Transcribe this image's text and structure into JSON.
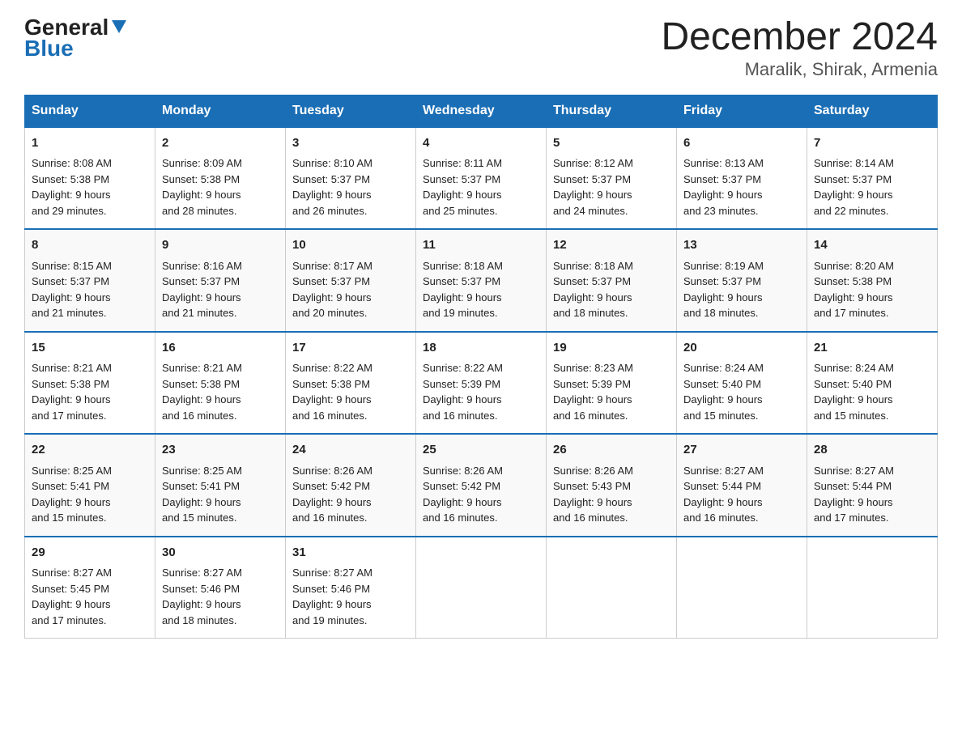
{
  "header": {
    "logo_line1": "General",
    "logo_line2": "Blue",
    "title": "December 2024",
    "subtitle": "Maralik, Shirak, Armenia"
  },
  "columns": [
    "Sunday",
    "Monday",
    "Tuesday",
    "Wednesday",
    "Thursday",
    "Friday",
    "Saturday"
  ],
  "weeks": [
    [
      {
        "day": "1",
        "info": "Sunrise: 8:08 AM\nSunset: 5:38 PM\nDaylight: 9 hours\nand 29 minutes."
      },
      {
        "day": "2",
        "info": "Sunrise: 8:09 AM\nSunset: 5:38 PM\nDaylight: 9 hours\nand 28 minutes."
      },
      {
        "day": "3",
        "info": "Sunrise: 8:10 AM\nSunset: 5:37 PM\nDaylight: 9 hours\nand 26 minutes."
      },
      {
        "day": "4",
        "info": "Sunrise: 8:11 AM\nSunset: 5:37 PM\nDaylight: 9 hours\nand 25 minutes."
      },
      {
        "day": "5",
        "info": "Sunrise: 8:12 AM\nSunset: 5:37 PM\nDaylight: 9 hours\nand 24 minutes."
      },
      {
        "day": "6",
        "info": "Sunrise: 8:13 AM\nSunset: 5:37 PM\nDaylight: 9 hours\nand 23 minutes."
      },
      {
        "day": "7",
        "info": "Sunrise: 8:14 AM\nSunset: 5:37 PM\nDaylight: 9 hours\nand 22 minutes."
      }
    ],
    [
      {
        "day": "8",
        "info": "Sunrise: 8:15 AM\nSunset: 5:37 PM\nDaylight: 9 hours\nand 21 minutes."
      },
      {
        "day": "9",
        "info": "Sunrise: 8:16 AM\nSunset: 5:37 PM\nDaylight: 9 hours\nand 21 minutes."
      },
      {
        "day": "10",
        "info": "Sunrise: 8:17 AM\nSunset: 5:37 PM\nDaylight: 9 hours\nand 20 minutes."
      },
      {
        "day": "11",
        "info": "Sunrise: 8:18 AM\nSunset: 5:37 PM\nDaylight: 9 hours\nand 19 minutes."
      },
      {
        "day": "12",
        "info": "Sunrise: 8:18 AM\nSunset: 5:37 PM\nDaylight: 9 hours\nand 18 minutes."
      },
      {
        "day": "13",
        "info": "Sunrise: 8:19 AM\nSunset: 5:37 PM\nDaylight: 9 hours\nand 18 minutes."
      },
      {
        "day": "14",
        "info": "Sunrise: 8:20 AM\nSunset: 5:38 PM\nDaylight: 9 hours\nand 17 minutes."
      }
    ],
    [
      {
        "day": "15",
        "info": "Sunrise: 8:21 AM\nSunset: 5:38 PM\nDaylight: 9 hours\nand 17 minutes."
      },
      {
        "day": "16",
        "info": "Sunrise: 8:21 AM\nSunset: 5:38 PM\nDaylight: 9 hours\nand 16 minutes."
      },
      {
        "day": "17",
        "info": "Sunrise: 8:22 AM\nSunset: 5:38 PM\nDaylight: 9 hours\nand 16 minutes."
      },
      {
        "day": "18",
        "info": "Sunrise: 8:22 AM\nSunset: 5:39 PM\nDaylight: 9 hours\nand 16 minutes."
      },
      {
        "day": "19",
        "info": "Sunrise: 8:23 AM\nSunset: 5:39 PM\nDaylight: 9 hours\nand 16 minutes."
      },
      {
        "day": "20",
        "info": "Sunrise: 8:24 AM\nSunset: 5:40 PM\nDaylight: 9 hours\nand 15 minutes."
      },
      {
        "day": "21",
        "info": "Sunrise: 8:24 AM\nSunset: 5:40 PM\nDaylight: 9 hours\nand 15 minutes."
      }
    ],
    [
      {
        "day": "22",
        "info": "Sunrise: 8:25 AM\nSunset: 5:41 PM\nDaylight: 9 hours\nand 15 minutes."
      },
      {
        "day": "23",
        "info": "Sunrise: 8:25 AM\nSunset: 5:41 PM\nDaylight: 9 hours\nand 15 minutes."
      },
      {
        "day": "24",
        "info": "Sunrise: 8:26 AM\nSunset: 5:42 PM\nDaylight: 9 hours\nand 16 minutes."
      },
      {
        "day": "25",
        "info": "Sunrise: 8:26 AM\nSunset: 5:42 PM\nDaylight: 9 hours\nand 16 minutes."
      },
      {
        "day": "26",
        "info": "Sunrise: 8:26 AM\nSunset: 5:43 PM\nDaylight: 9 hours\nand 16 minutes."
      },
      {
        "day": "27",
        "info": "Sunrise: 8:27 AM\nSunset: 5:44 PM\nDaylight: 9 hours\nand 16 minutes."
      },
      {
        "day": "28",
        "info": "Sunrise: 8:27 AM\nSunset: 5:44 PM\nDaylight: 9 hours\nand 17 minutes."
      }
    ],
    [
      {
        "day": "29",
        "info": "Sunrise: 8:27 AM\nSunset: 5:45 PM\nDaylight: 9 hours\nand 17 minutes."
      },
      {
        "day": "30",
        "info": "Sunrise: 8:27 AM\nSunset: 5:46 PM\nDaylight: 9 hours\nand 18 minutes."
      },
      {
        "day": "31",
        "info": "Sunrise: 8:27 AM\nSunset: 5:46 PM\nDaylight: 9 hours\nand 19 minutes."
      },
      {
        "day": "",
        "info": ""
      },
      {
        "day": "",
        "info": ""
      },
      {
        "day": "",
        "info": ""
      },
      {
        "day": "",
        "info": ""
      }
    ]
  ]
}
